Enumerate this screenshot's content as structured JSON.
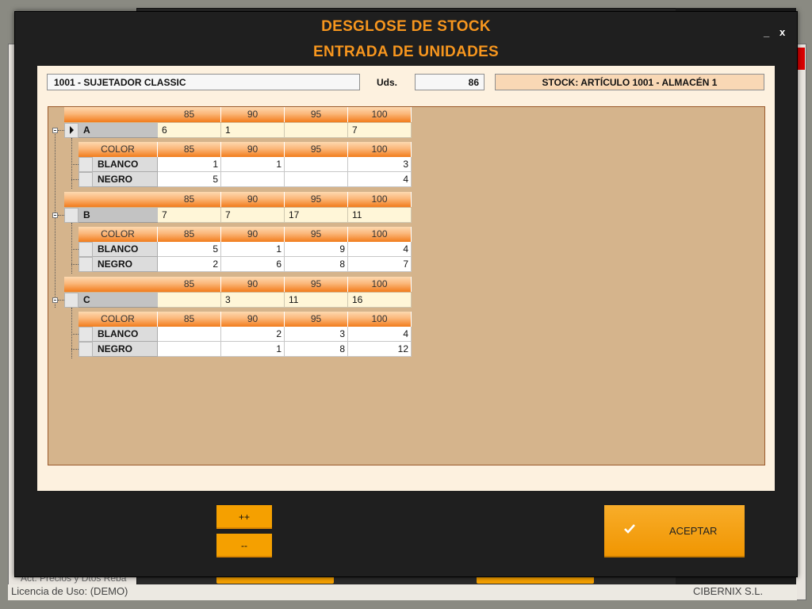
{
  "background": {
    "license_text": "Licencia de Uso: (DEMO)",
    "company_text": "CIBERNIX S.L.",
    "act_precios": "Act. Precios y Dtos Reba"
  },
  "dialog": {
    "title_line1": "DESGLOSE DE STOCK",
    "title_line2": "ENTRADA DE UNIDADES",
    "minimize": "_",
    "close": "x",
    "article": "1001 - SUJETADOR CLASSIC",
    "uds_label": "Uds.",
    "uds_value": "86",
    "stock_label": "STOCK: ARTÍCULO 1001 - ALMACÉN 1",
    "buttons": {
      "plus": "++",
      "minus": "--",
      "accept": "ACEPTAR"
    }
  },
  "grid": {
    "sizes": [
      "85",
      "90",
      "95",
      "100"
    ],
    "color_header": "COLOR",
    "groups": [
      {
        "name": "A",
        "totals": [
          "6",
          "1",
          "",
          "7"
        ],
        "colors": [
          {
            "name": "BLANCO",
            "values": [
              "1",
              "1",
              "",
              "3"
            ]
          },
          {
            "name": "NEGRO",
            "values": [
              "5",
              "",
              "",
              "4"
            ]
          }
        ]
      },
      {
        "name": "B",
        "totals": [
          "7",
          "7",
          "17",
          "11"
        ],
        "colors": [
          {
            "name": "BLANCO",
            "values": [
              "5",
              "1",
              "9",
              "4"
            ]
          },
          {
            "name": "NEGRO",
            "values": [
              "2",
              "6",
              "8",
              "7"
            ]
          }
        ]
      },
      {
        "name": "C",
        "totals": [
          "",
          "3",
          "11",
          "16"
        ],
        "colors": [
          {
            "name": "BLANCO",
            "values": [
              "",
              "2",
              "3",
              "4"
            ]
          },
          {
            "name": "NEGRO",
            "values": [
              "",
              "1",
              "8",
              "12"
            ]
          }
        ]
      }
    ]
  }
}
